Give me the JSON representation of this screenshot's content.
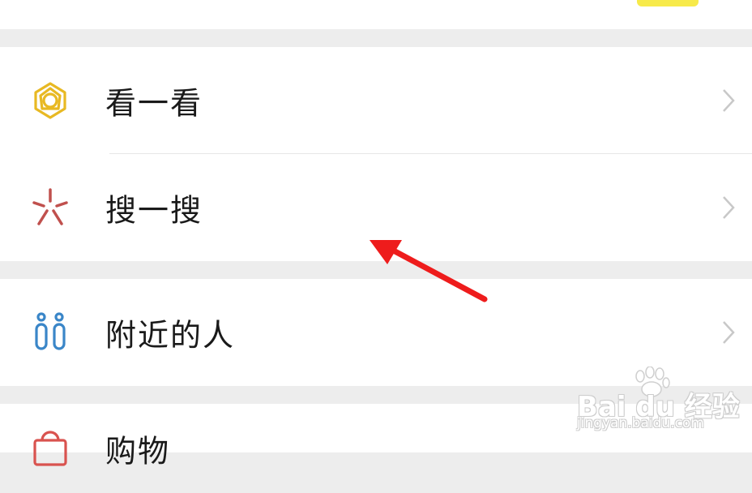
{
  "menu": {
    "items": [
      {
        "id": "kanyikan",
        "label": "看一看",
        "icon": "flower-hexagon-icon",
        "icon_color": "#e8b923"
      },
      {
        "id": "souyisou",
        "label": "搜一搜",
        "icon": "search-star-icon",
        "icon_color": "#c0504d"
      },
      {
        "id": "fujin",
        "label": "附近的人",
        "icon": "people-icon",
        "icon_color": "#3a86c8"
      },
      {
        "id": "gouwu",
        "label": "购物",
        "icon": "shopping-bag-icon",
        "icon_color": "#d9534f"
      }
    ]
  },
  "watermark": {
    "brand": "Bai du 经验",
    "url": "jingyan.baidu.com"
  },
  "colors": {
    "annotation_arrow": "#ee1c1c",
    "background": "#ededed",
    "card": "#ffffff"
  }
}
